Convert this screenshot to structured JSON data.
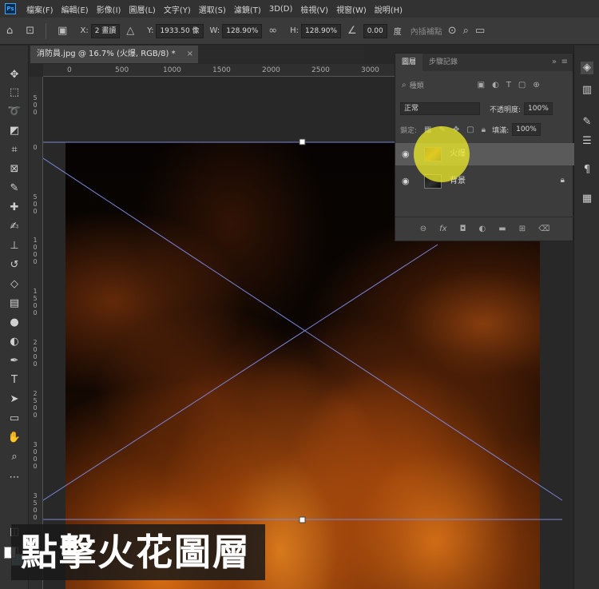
{
  "app": {
    "logo_text": "Ps"
  },
  "menu": [
    "檔案(F)",
    "編輯(E)",
    "影像(I)",
    "圖層(L)",
    "文字(Y)",
    "選取(S)",
    "濾鏡(T)",
    "3D(D)",
    "檢視(V)",
    "視窗(W)",
    "說明(H)"
  ],
  "options": {
    "x_label": "X:",
    "x_value": "2 畫讀",
    "y_label": "Y:",
    "y_value": "1933.50 像",
    "w_label": "W:",
    "w_value": "128.90%",
    "h_label": "H:",
    "h_value": "128.90%",
    "angle_value": "0.00",
    "angle_unit": "度",
    "interp_label": "內插補點"
  },
  "document_tab": {
    "title": "消防員.jpg @ 16.7% (火爆, RGB/8) *",
    "close": "×"
  },
  "ruler_top": [
    "0",
    "500",
    "1000",
    "1500",
    "2000",
    "2500",
    "3000"
  ],
  "ruler_left": [
    "5\n0\n0",
    "0",
    "5\n0\n0",
    "1\n0\n0\n0",
    "1\n5\n0\n0",
    "2\n0\n0\n0",
    "2\n5\n0\n0",
    "3\n0\n0\n0",
    "3\n5\n0\n0"
  ],
  "layers_panel": {
    "tabs": [
      "圖層",
      "步驟記錄"
    ],
    "collapse": "»",
    "menu": "≡",
    "search_placeholder": "種類",
    "blend_mode": "正常",
    "opacity_label": "不透明度:",
    "opacity_value": "100%",
    "lock_label": "鎖定:",
    "fill_label": "填滿:",
    "fill_value": "100%",
    "layers": [
      {
        "name": "火爆",
        "visible": true,
        "selected": true
      },
      {
        "name": "背景",
        "visible": true,
        "selected": false,
        "locked": true
      }
    ],
    "footer_icons": [
      "link-icon",
      "fx-icon",
      "mask-icon",
      "adjustment-icon",
      "group-icon",
      "new-layer-icon",
      "trash-icon"
    ]
  },
  "caption": "點擊火花圖層",
  "colors": {
    "highlight": "#e8e628",
    "foreground": "#ffffff",
    "background_swatch": "#9ad0d8",
    "transform_lines": "#7b86d8"
  }
}
